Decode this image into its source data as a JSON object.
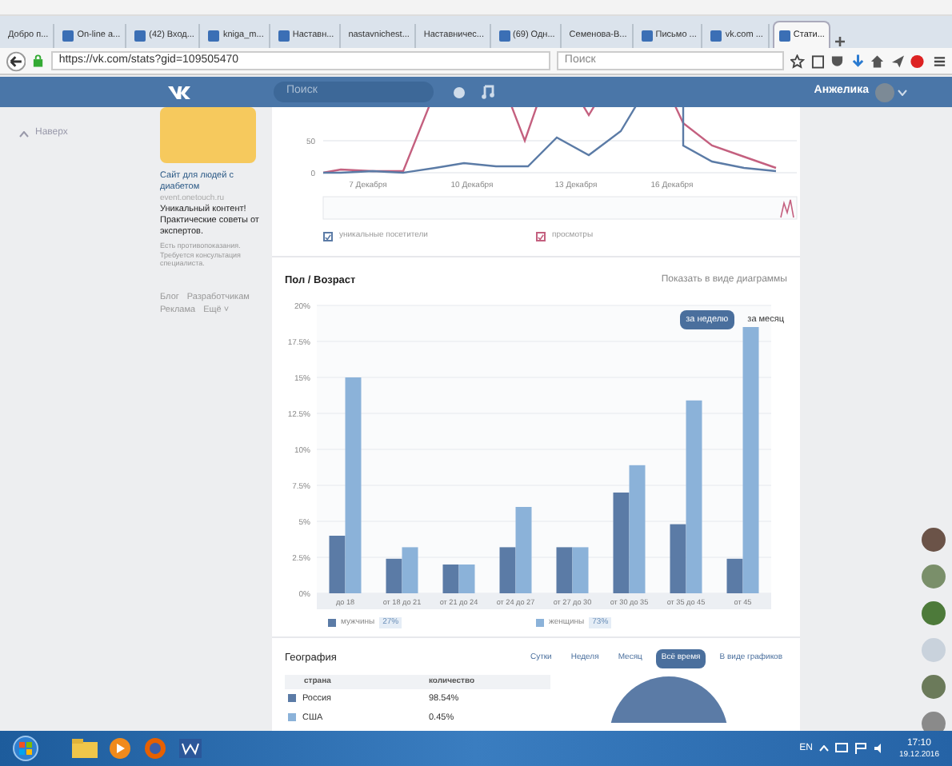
{
  "browser": {
    "tabs": [
      {
        "label": "Добро п...",
        "has_icon": false,
        "selected": false
      },
      {
        "label": "On-line a...",
        "has_icon": true,
        "selected": false
      },
      {
        "label": "(42) Вход...",
        "has_icon": true,
        "selected": false
      },
      {
        "label": "kniga_m...",
        "has_icon": true,
        "selected": false
      },
      {
        "label": "Наставн...",
        "has_icon": true,
        "selected": false
      },
      {
        "label": "nastavnichest...",
        "has_icon": false,
        "selected": false
      },
      {
        "label": "Наставничес...",
        "has_icon": false,
        "selected": false
      },
      {
        "label": "(69) Одн...",
        "has_icon": true,
        "selected": false
      },
      {
        "label": "Семенова-В...",
        "has_icon": false,
        "selected": false
      },
      {
        "label": "Письмо ...",
        "has_icon": true,
        "selected": false
      },
      {
        "label": "vk.com ...",
        "has_icon": true,
        "selected": false
      },
      {
        "label": "Стати...",
        "has_icon": true,
        "selected": true
      }
    ],
    "url": "https://vk.com/stats?gid=109505470",
    "search_placeholder": "Поиск"
  },
  "vk_header": {
    "search_placeholder": "Поиск",
    "user_name": "Анжелика"
  },
  "sidebar": {
    "back_link": "Наверх",
    "ad": {
      "title": "Сайт для людей с диабетом",
      "domain": "event.onetouch.ru",
      "text": "Уникальный контент! Практические советы от экспертов.",
      "disclaimer": "Есть противопоказания. Требуется консультация специалиста."
    },
    "footer_links": [
      "Блог",
      "Разработчикам",
      "Реклама",
      "Ещё ˅"
    ]
  },
  "visits": {
    "y_labels": [
      "50",
      "0"
    ],
    "x_labels": [
      "7 Декабря",
      "10 Декабря",
      "13 Декабря",
      "16 Декабря"
    ],
    "legend": [
      {
        "label": "уникальные посетители",
        "checked": true
      },
      {
        "label": "просмотры",
        "checked": true
      }
    ]
  },
  "gender_age": {
    "title": "Пол / Возраст",
    "view_link": "Показать в виде диаграммы",
    "periods": [
      {
        "label": "за неделю",
        "selected": true
      },
      {
        "label": "за месяц",
        "selected": false
      }
    ],
    "chart_data": {
      "type": "bar",
      "categories": [
        "до 18",
        "от 18 до 21",
        "от 21 до 24",
        "от 24 до 27",
        "от 27 до 30",
        "от 30 до 35",
        "от 35 до 45",
        "от 45"
      ],
      "series": [
        {
          "name": "мужчины",
          "color": "#5b7ba6",
          "values": [
            4,
            2.4,
            2,
            3.2,
            3.2,
            7,
            4.8,
            2.4
          ]
        },
        {
          "name": "женщины",
          "color": "#8bb2d9",
          "values": [
            15,
            3.2,
            2,
            6,
            3.2,
            8.9,
            13.4,
            18.5
          ]
        }
      ],
      "grid": true,
      "ylim": [
        0,
        20
      ],
      "yticks": [
        {
          "value": 0,
          "label": "0%"
        },
        {
          "value": 2.5,
          "label": "2.5%"
        },
        {
          "value": 5,
          "label": "5%"
        },
        {
          "value": 7.5,
          "label": "7.5%"
        },
        {
          "value": 10,
          "label": "10%"
        },
        {
          "value": 12.5,
          "label": "12.5%"
        },
        {
          "value": 15,
          "label": "15%"
        },
        {
          "value": 17.5,
          "label": "17.5%"
        },
        {
          "value": 20,
          "label": "20%"
        }
      ]
    },
    "legend_shares": [
      "27%",
      "73%"
    ]
  },
  "geography": {
    "title": "География",
    "periods": [
      {
        "label": "Сутки",
        "selected": false
      },
      {
        "label": "Неделя",
        "selected": false
      },
      {
        "label": "Месяц",
        "selected": false
      },
      {
        "label": "Всё время",
        "selected": true
      },
      {
        "label": "В виде графиков",
        "selected": false
      }
    ],
    "columns": [
      "страна",
      "количество"
    ],
    "rows": [
      {
        "country": "Россия",
        "count": "98.54%",
        "color": "#5b7ba6"
      },
      {
        "country": "США",
        "count": "0.45%",
        "color": "#8bb2d9"
      }
    ]
  },
  "taskbar": {
    "language": "EN",
    "time": "17:10",
    "date": "19.12.2016"
  }
}
